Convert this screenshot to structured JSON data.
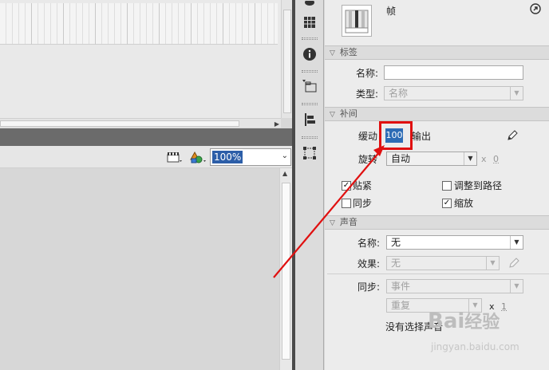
{
  "zoom": {
    "value": "100%"
  },
  "properties": {
    "title": "帧",
    "label_section": {
      "header": "标签",
      "name_label": "名称:",
      "name_value": "",
      "type_label": "类型:",
      "type_value": "名称"
    },
    "tween_section": {
      "header": "补间",
      "ease_label": "缓动",
      "ease_value": "100",
      "ease_out": "输出",
      "rotate_label": "旋转",
      "rotate_value": "自动",
      "times_x": "x",
      "times_value": "0",
      "checkboxes": [
        {
          "label": "贴紧",
          "checked": true
        },
        {
          "label": "调整到路径",
          "checked": false
        },
        {
          "label": "同步",
          "checked": false
        },
        {
          "label": "缩放",
          "checked": true
        }
      ]
    },
    "sound_section": {
      "header": "声音",
      "name_label": "名称:",
      "name_value": "无",
      "effect_label": "效果:",
      "effect_value": "无",
      "sync_label": "同步:",
      "sync_value": "事件",
      "repeat_value": "重复",
      "times_x": "x",
      "times_value": "1",
      "no_sound": "没有选择声音"
    }
  },
  "watermark": {
    "brand": "Bai",
    "brand2": "经验",
    "url": "jingyan.baidu.com"
  },
  "colors": {
    "highlight": "#e01010",
    "selection": "#2d6cb5"
  }
}
